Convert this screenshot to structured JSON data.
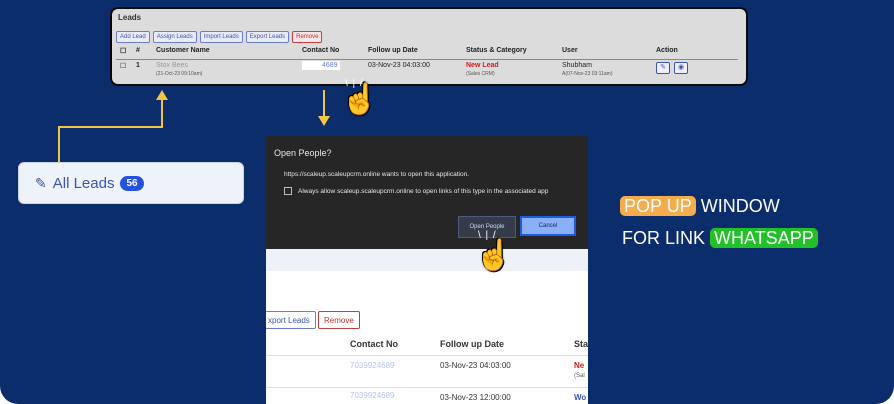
{
  "leads_panel": {
    "title": "Leads",
    "buttons": [
      "Add Lead",
      "Assign Leads",
      "Import Leads",
      "Export Leads",
      "Remove"
    ],
    "headers": [
      "#",
      "Customer Name",
      "Contact No",
      "Follow up Date",
      "Status & Category",
      "User",
      "Action"
    ],
    "row": {
      "index": "1",
      "name": "Stox Bees",
      "name_sub": "(21-Oct-23 09:10am)",
      "contact": "4689",
      "follow_up": "03-Nov-23 04:03:00",
      "status": "New Lead",
      "status_sub": "(Sales CRM)",
      "user": "Shubham",
      "user_sub": "A(07-Nov-23 03:11am)"
    }
  },
  "all_leads": {
    "label": "All Leads",
    "count": "56"
  },
  "dialog": {
    "title": "Open People?",
    "message": "https://scaleup.scaleupcrm.online wants to open this application.",
    "checkbox_label": "Always allow scaleup.scaleupcrm.online to open links of this type in the associated app",
    "open_button": "Open People",
    "cancel_button": "Cancel"
  },
  "lower_table": {
    "export_label": "xport Leads",
    "remove_label": "Remove",
    "headers": [
      "Contact No",
      "Follow up Date",
      "Sta"
    ],
    "rows": [
      {
        "contact": "7039924689",
        "follow_up": "03-Nov-23 04:03:00",
        "status": "Ne",
        "status_sub": "(Sal"
      },
      {
        "contact": "7039924689",
        "follow_up": "03-Nov-23 12:00:00",
        "status": "Wo",
        "status_sub": ""
      }
    ]
  },
  "side_caption": {
    "line1_highlight": "POP UP",
    "line1_rest": "WINDOW",
    "line2_rest": "FOR LINK",
    "line2_highlight": "WHATSAPP"
  },
  "colors": {
    "background": "#0c2d6b",
    "arrow": "#f4c542",
    "orange": "#f5ac4d",
    "green": "#22c12a",
    "status_red": "#d02020",
    "link_blue": "#3b55b5"
  }
}
